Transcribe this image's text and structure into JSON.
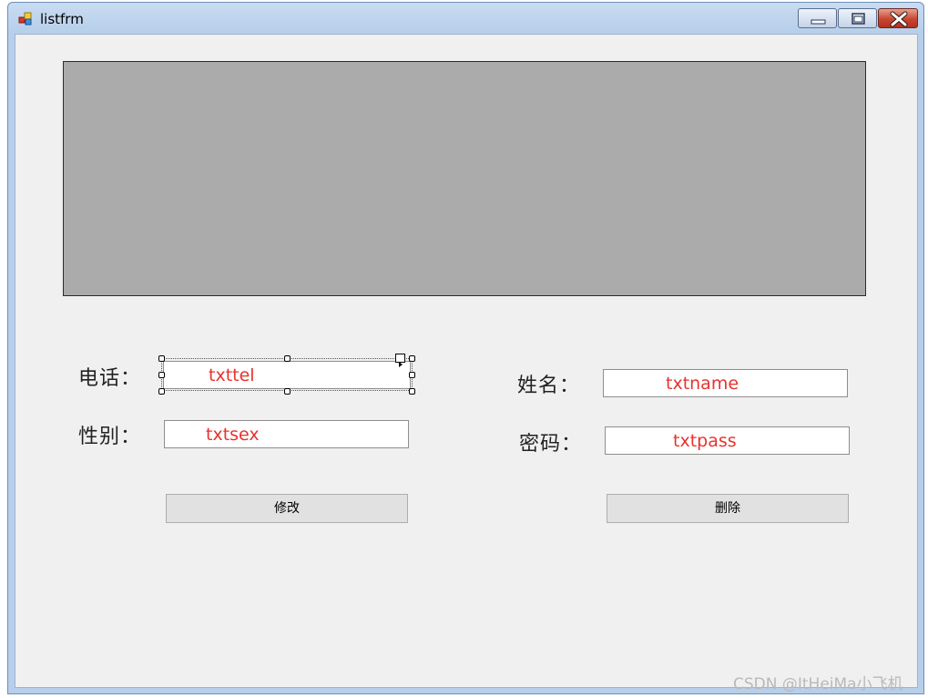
{
  "window": {
    "title": "listfrm"
  },
  "form": {
    "phone_label": "电话：",
    "name_label": "姓名：",
    "sex_label": "性别：",
    "password_label": "密码：",
    "txttel": "txttel",
    "txtname": "txtname",
    "txtsex": "txtsex",
    "txtpass": "txtpass",
    "modify_button": "修改",
    "delete_button": "删除"
  },
  "watermark": "CSDN @ItHeiMa小飞机",
  "colors": {
    "placeholder_text": "#e8322e",
    "grid_background": "#ababab",
    "form_background": "#f0f0f0"
  },
  "icons": {
    "app": "app-icon",
    "minimize": "minimize-icon",
    "maximize": "maximize-icon",
    "close": "close-icon"
  }
}
